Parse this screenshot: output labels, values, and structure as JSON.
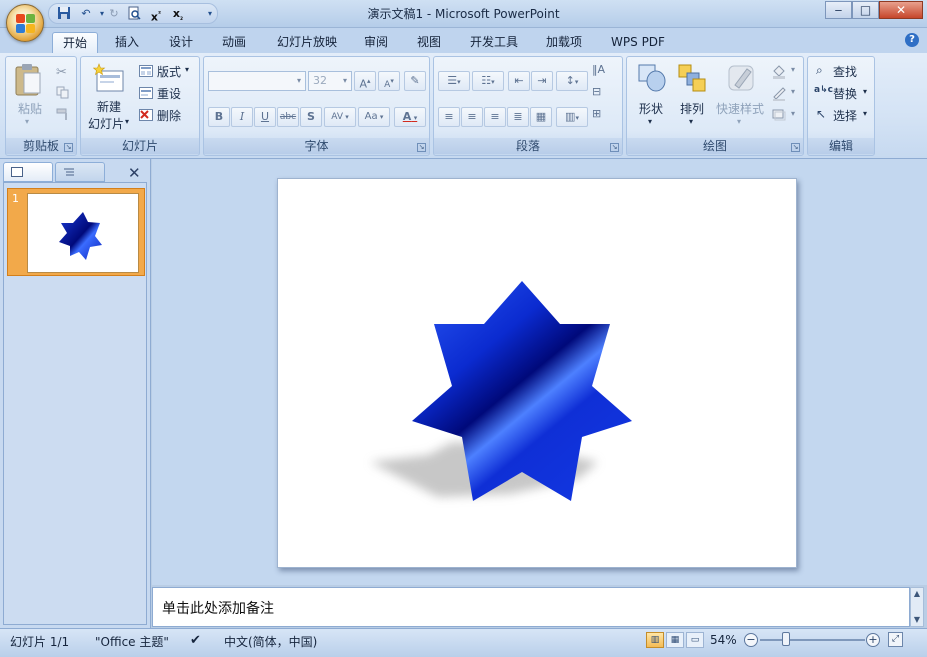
{
  "window": {
    "title": "演示文稿1 - Microsoft PowerPoint"
  },
  "qat": {
    "icons": [
      "save-icon",
      "undo-icon",
      "redo-icon",
      "print-preview-icon",
      "superscript-icon",
      "subscript-icon",
      "customize-icon"
    ]
  },
  "tabs": [
    {
      "label": "开始",
      "active": true
    },
    {
      "label": "插入"
    },
    {
      "label": "设计"
    },
    {
      "label": "动画"
    },
    {
      "label": "幻灯片放映"
    },
    {
      "label": "审阅"
    },
    {
      "label": "视图"
    },
    {
      "label": "开发工具"
    },
    {
      "label": "加载项"
    },
    {
      "label": "WPS PDF"
    }
  ],
  "ribbon": {
    "clipboard": {
      "label": "剪贴板",
      "paste": "粘贴"
    },
    "slides": {
      "label": "幻灯片",
      "new_slide_line1": "新建",
      "new_slide_line2": "幻灯片",
      "layout": "版式",
      "reset": "重设",
      "delete": "删除"
    },
    "font": {
      "label": "字体",
      "font_size": "32",
      "bold": "B",
      "italic": "I",
      "underline": "U",
      "strike": "abc",
      "shadow": "S",
      "spacing": "AV",
      "case": "Aa",
      "color": "A",
      "grow": "A",
      "shrink": "A"
    },
    "paragraph": {
      "label": "段落"
    },
    "drawing": {
      "label": "绘图",
      "shape": "形状",
      "arrange": "排列",
      "quick_styles": "快速样式"
    },
    "editing": {
      "label": "编辑",
      "find": "查找",
      "replace": "替换",
      "select": "选择"
    }
  },
  "pane": {
    "slide_number": "1",
    "close": "✕"
  },
  "notes": {
    "placeholder": "单击此处添加备注"
  },
  "status": {
    "slide": "幻灯片 1/1",
    "theme": "\"Office 主题\"",
    "language": "中文(简体，中国)",
    "zoom": "54%"
  },
  "colors": {
    "star_dark": "#00097a",
    "star_light": "#2a66ff",
    "accent": "#f2a94a"
  }
}
